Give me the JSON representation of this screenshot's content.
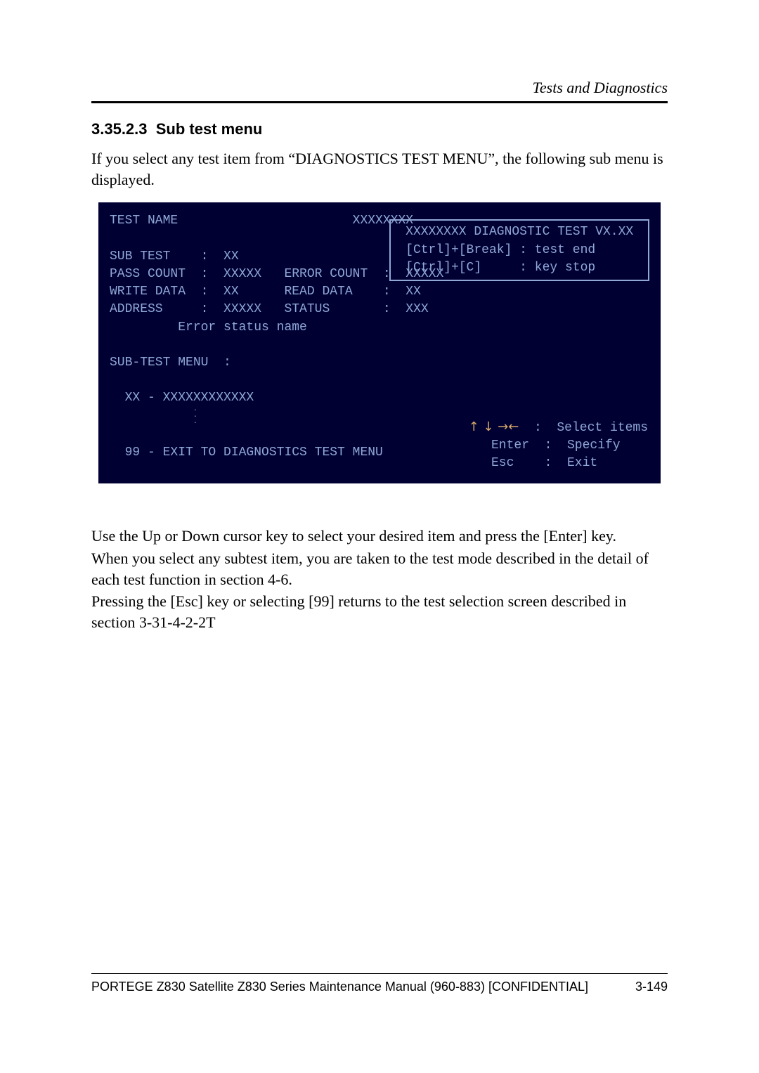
{
  "header": {
    "running_title": "Tests and Diagnostics"
  },
  "section": {
    "number": "3.35.2.3",
    "title": "Sub test menu",
    "intro": "If you select any test item from “DIAGNOSTICS TEST MENU”, the following sub menu is displayed."
  },
  "terminal": {
    "line_test_name": "TEST NAME                       XXXXXXXX",
    "line_sub_test": "SUB TEST    :  XX",
    "line_pass": "PASS COUNT  :  XXXXX   ERROR COUNT  :  XXXXX",
    "line_write": "WRITE DATA  :  XX      READ DATA    :  XX",
    "line_addr": "ADDRESS     :  XXXXX   STATUS       :  XXX",
    "line_err": "         Error status name",
    "line_menu_hdr": "SUB-TEST MENU  :",
    "line_item": "  XX - XXXXXXXXXXXX",
    "line_exit": "  99 - EXIT TO DIAGNOSTICS TEST MENU",
    "box_title": " XXXXXXXX DIAGNOSTIC TEST VX.XX ",
    "box_l1": " [Ctrl]+[Break] : test end",
    "box_l2": " [Ctrl]+[C]     : key stop",
    "legend_arrows": "↑ ↓ →←",
    "legend_select": "  :  Select items",
    "legend_enter": "   Enter  :  Specify",
    "legend_esc": "   Esc    :  Exit"
  },
  "after_text_1": "Use the Up or Down cursor key to select your desired item and press the [Enter] key.",
  "after_text_2": "When you select any subtest item, you are taken to the test mode described in the detail of each test function in section 4-6.",
  "after_text_3": "Pressing the [Esc] key or selecting [99] returns to the test selection screen described in section 3-31-4-2-2T",
  "footer": {
    "manual_title": "PORTEGE Z830 Satellite Z830 Series Maintenance Manual (960-883) ",
    "confidential": "[CONFIDENTIAL]",
    "page_number": "3-149"
  }
}
